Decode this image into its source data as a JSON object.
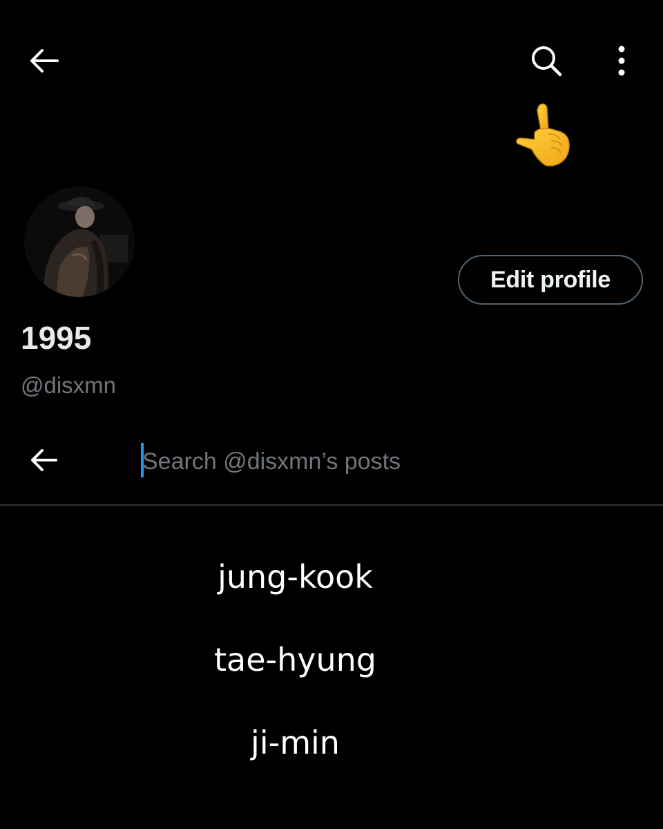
{
  "header": {
    "back_icon": "arrow-left-icon",
    "search_icon": "search-icon",
    "more_icon": "more-vertical-icon"
  },
  "annotation": {
    "emoji": "👆"
  },
  "profile": {
    "display_name": "1995",
    "handle": "@disxmn",
    "edit_button_label": "Edit profile"
  },
  "search": {
    "back_icon": "arrow-left-icon",
    "placeholder": "Search @disxmn’s posts",
    "value": ""
  },
  "names": [
    "jung-kook",
    "tae-hyung",
    "ji-min"
  ],
  "colors": {
    "background": "#000000",
    "text_primary": "#e7e9ea",
    "text_secondary": "#71767b",
    "accent": "#1d9bf0",
    "border": "#536471",
    "divider": "#2f3336"
  }
}
